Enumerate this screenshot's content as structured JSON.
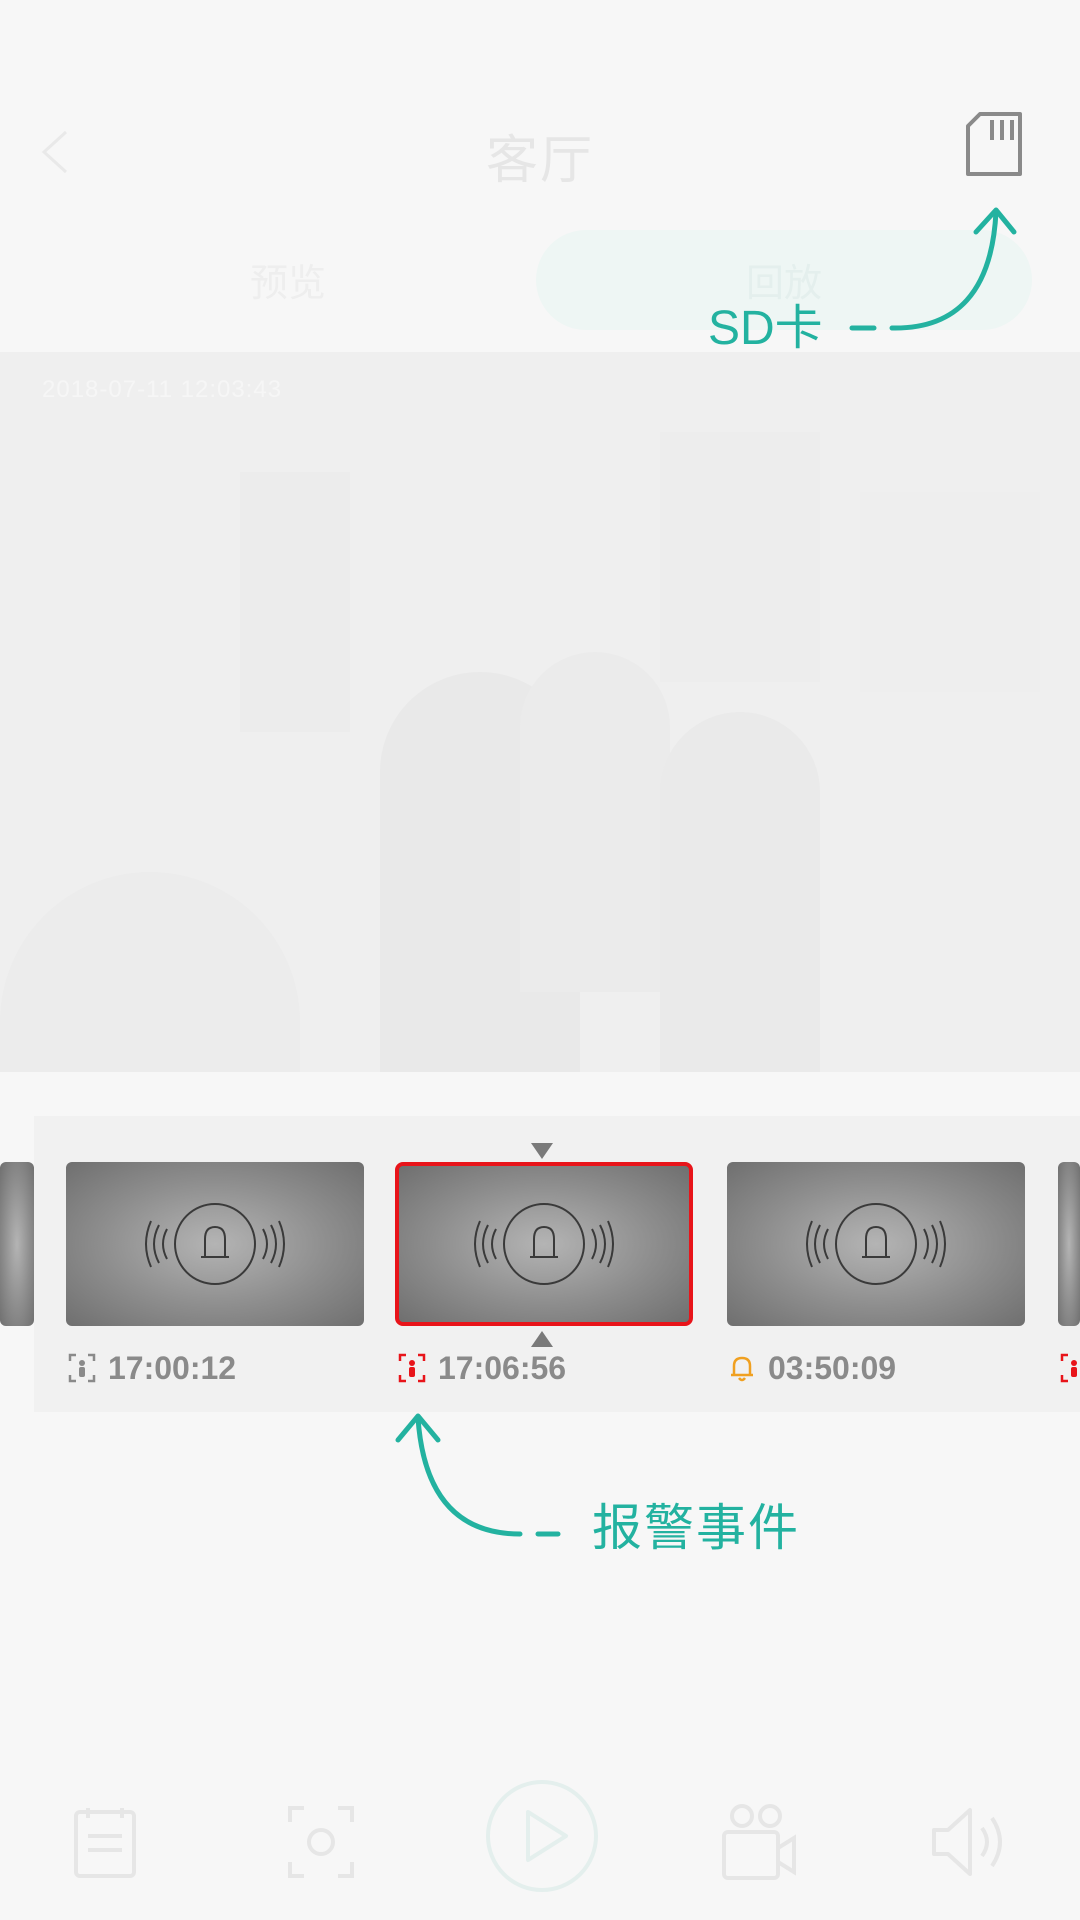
{
  "header": {
    "title": "客厅",
    "back_icon": "chevron-left-icon",
    "sd_card_icon": "sd-card-icon"
  },
  "segment": {
    "preview_label": "预览",
    "playback_label": "回放",
    "selected": "playback"
  },
  "video": {
    "osd_timestamp": "2018-07-11  12:03:43"
  },
  "events": [
    {
      "time": "17:00:12",
      "type": "person-detect",
      "icon": "person-detect-icon",
      "icon_color": "#8a8a8a",
      "selected": false
    },
    {
      "time": "17:06:56",
      "type": "person-detect",
      "icon": "person-detect-icon",
      "icon_color": "#e8141a",
      "selected": true
    },
    {
      "time": "03:50:09",
      "type": "alarm-bell",
      "icon": "bell-icon",
      "icon_color": "#f0a020",
      "selected": false
    }
  ],
  "annotations": {
    "sd_card": "SD卡",
    "alarm_events": "报警事件"
  },
  "colors": {
    "accent": "#23b2a0",
    "selected_border": "#e8141a"
  },
  "bottom_bar": [
    "clipboard-icon",
    "screenshot-icon",
    "play-icon",
    "video-record-icon",
    "speaker-icon"
  ]
}
